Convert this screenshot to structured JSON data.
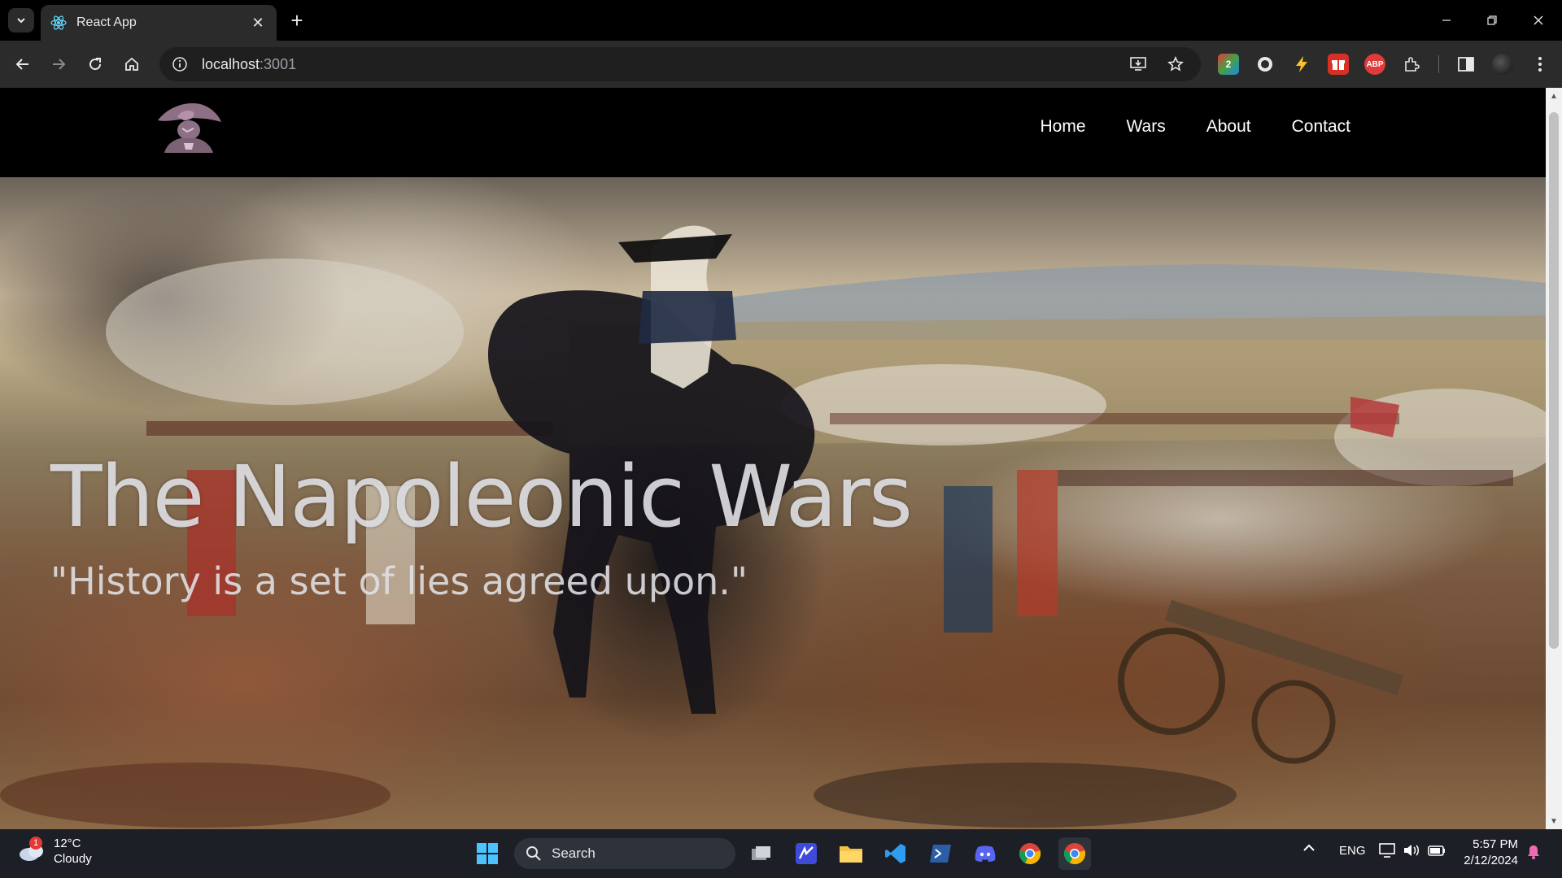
{
  "browser": {
    "tab_title": "React App",
    "url_host": "localhost",
    "url_port": ":3001"
  },
  "site": {
    "nav": [
      "Home",
      "Wars",
      "About",
      "Contact"
    ],
    "hero_title": "The Napoleonic Wars",
    "hero_quote": "\"History is a set of lies agreed upon.\""
  },
  "taskbar": {
    "weather_temp": "12°C",
    "weather_desc": "Cloudy",
    "weather_badge": "1",
    "search_label": "Search",
    "lang": "ENG",
    "time": "5:57 PM",
    "date": "2/12/2024"
  },
  "extensions": {
    "ext1_label": "2",
    "abp_label": "ABP"
  }
}
